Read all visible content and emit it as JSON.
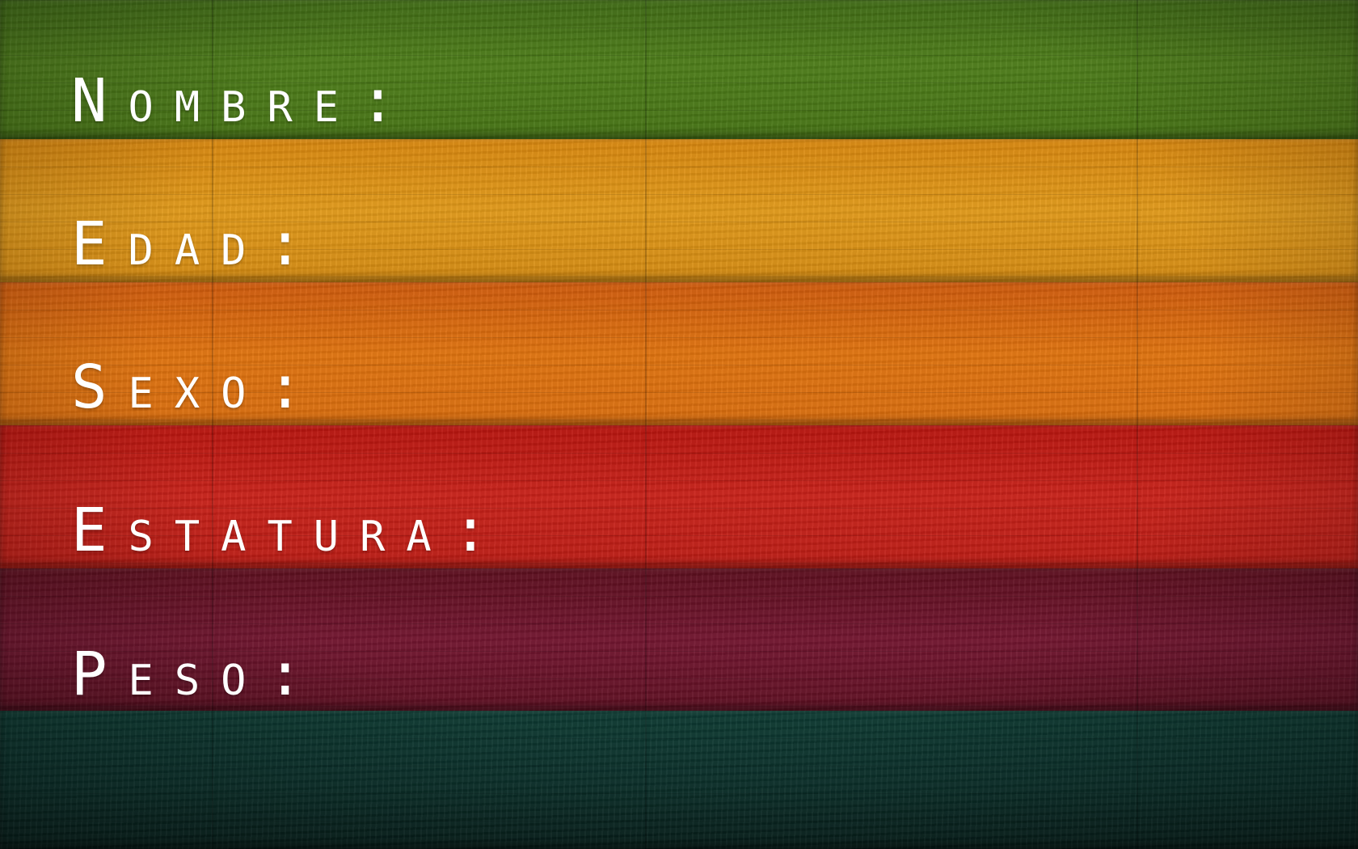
{
  "colors": {
    "plank_green": "#4e7d1a",
    "plank_yellow": "#e19a1a",
    "plank_orange": "#e0740f",
    "plank_red": "#c9221a",
    "plank_maroon": "#731630",
    "plank_teal": "#0b302a",
    "text": "#ffffff"
  },
  "fields": [
    {
      "label": "Nombre:"
    },
    {
      "label": "Edad:"
    },
    {
      "label": "Sexo:"
    },
    {
      "label": "Estatura:"
    },
    {
      "label": "Peso:"
    }
  ]
}
